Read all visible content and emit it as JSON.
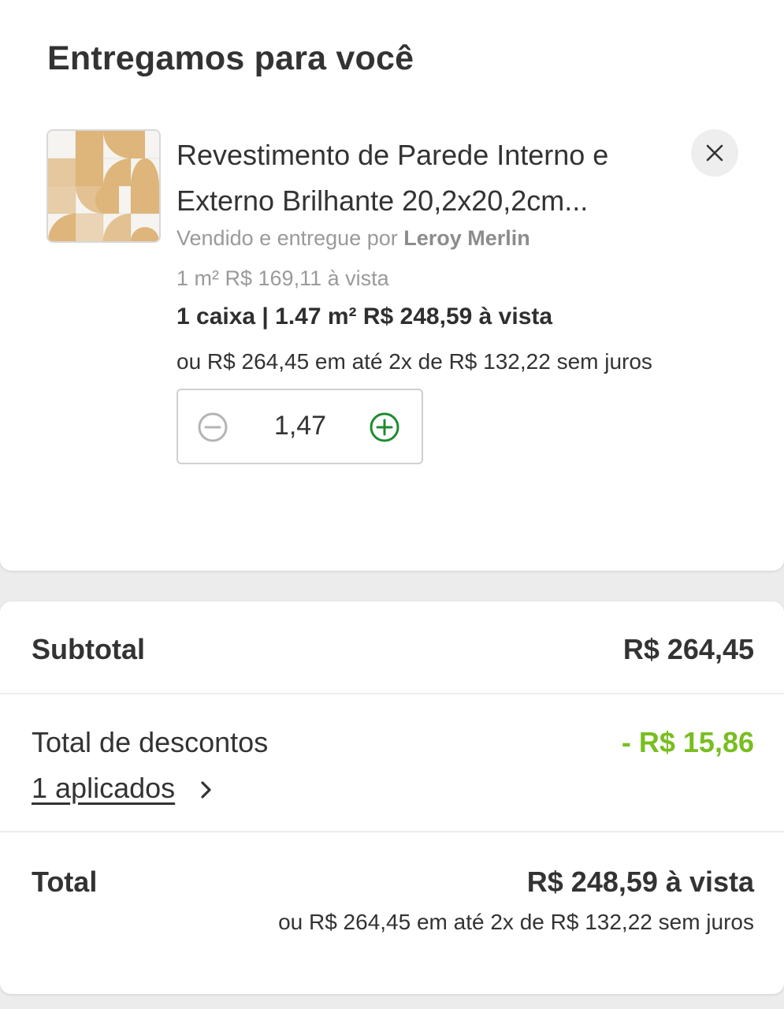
{
  "delivery": {
    "title": "Entregamos para você"
  },
  "product": {
    "name_line1": "Revestimento de Parede Interno e",
    "name_line2": "Externo Brilhante 20,2x20,2cm...",
    "seller_prefix": "Vendido e entregue por ",
    "seller_name": "Leroy Merlin",
    "unit_price": "1 m² R$ 169,11 à vista",
    "box_price": "1 caixa | 1.47 m² R$ 248,59 à vista",
    "installment": "ou R$ 264,45 em até 2x de R$ 132,22 sem juros",
    "quantity": "1,47",
    "colors": {
      "tile_orange": "#dcae6e",
      "tile_white": "#f6f4f0"
    }
  },
  "summary": {
    "subtotal_label": "Subtotal",
    "subtotal_value": "R$ 264,45",
    "discount_label": "Total de descontos",
    "discount_value": "- R$ 15,86",
    "discount_applied": "1 aplicados",
    "total_label": "Total",
    "total_value": "R$ 248,59 à vista",
    "total_installment": "ou R$ 264,45 em até 2x de R$ 132,22 sem juros"
  },
  "colors": {
    "accent_green": "#1e8c2e",
    "discount_green": "#78be20",
    "text_dark": "#333333",
    "text_muted": "#9a9a9a"
  },
  "icons": {
    "close": "close-icon",
    "minus": "minus-circle-icon",
    "plus": "plus-circle-icon",
    "chevron": "chevron-right-icon"
  }
}
